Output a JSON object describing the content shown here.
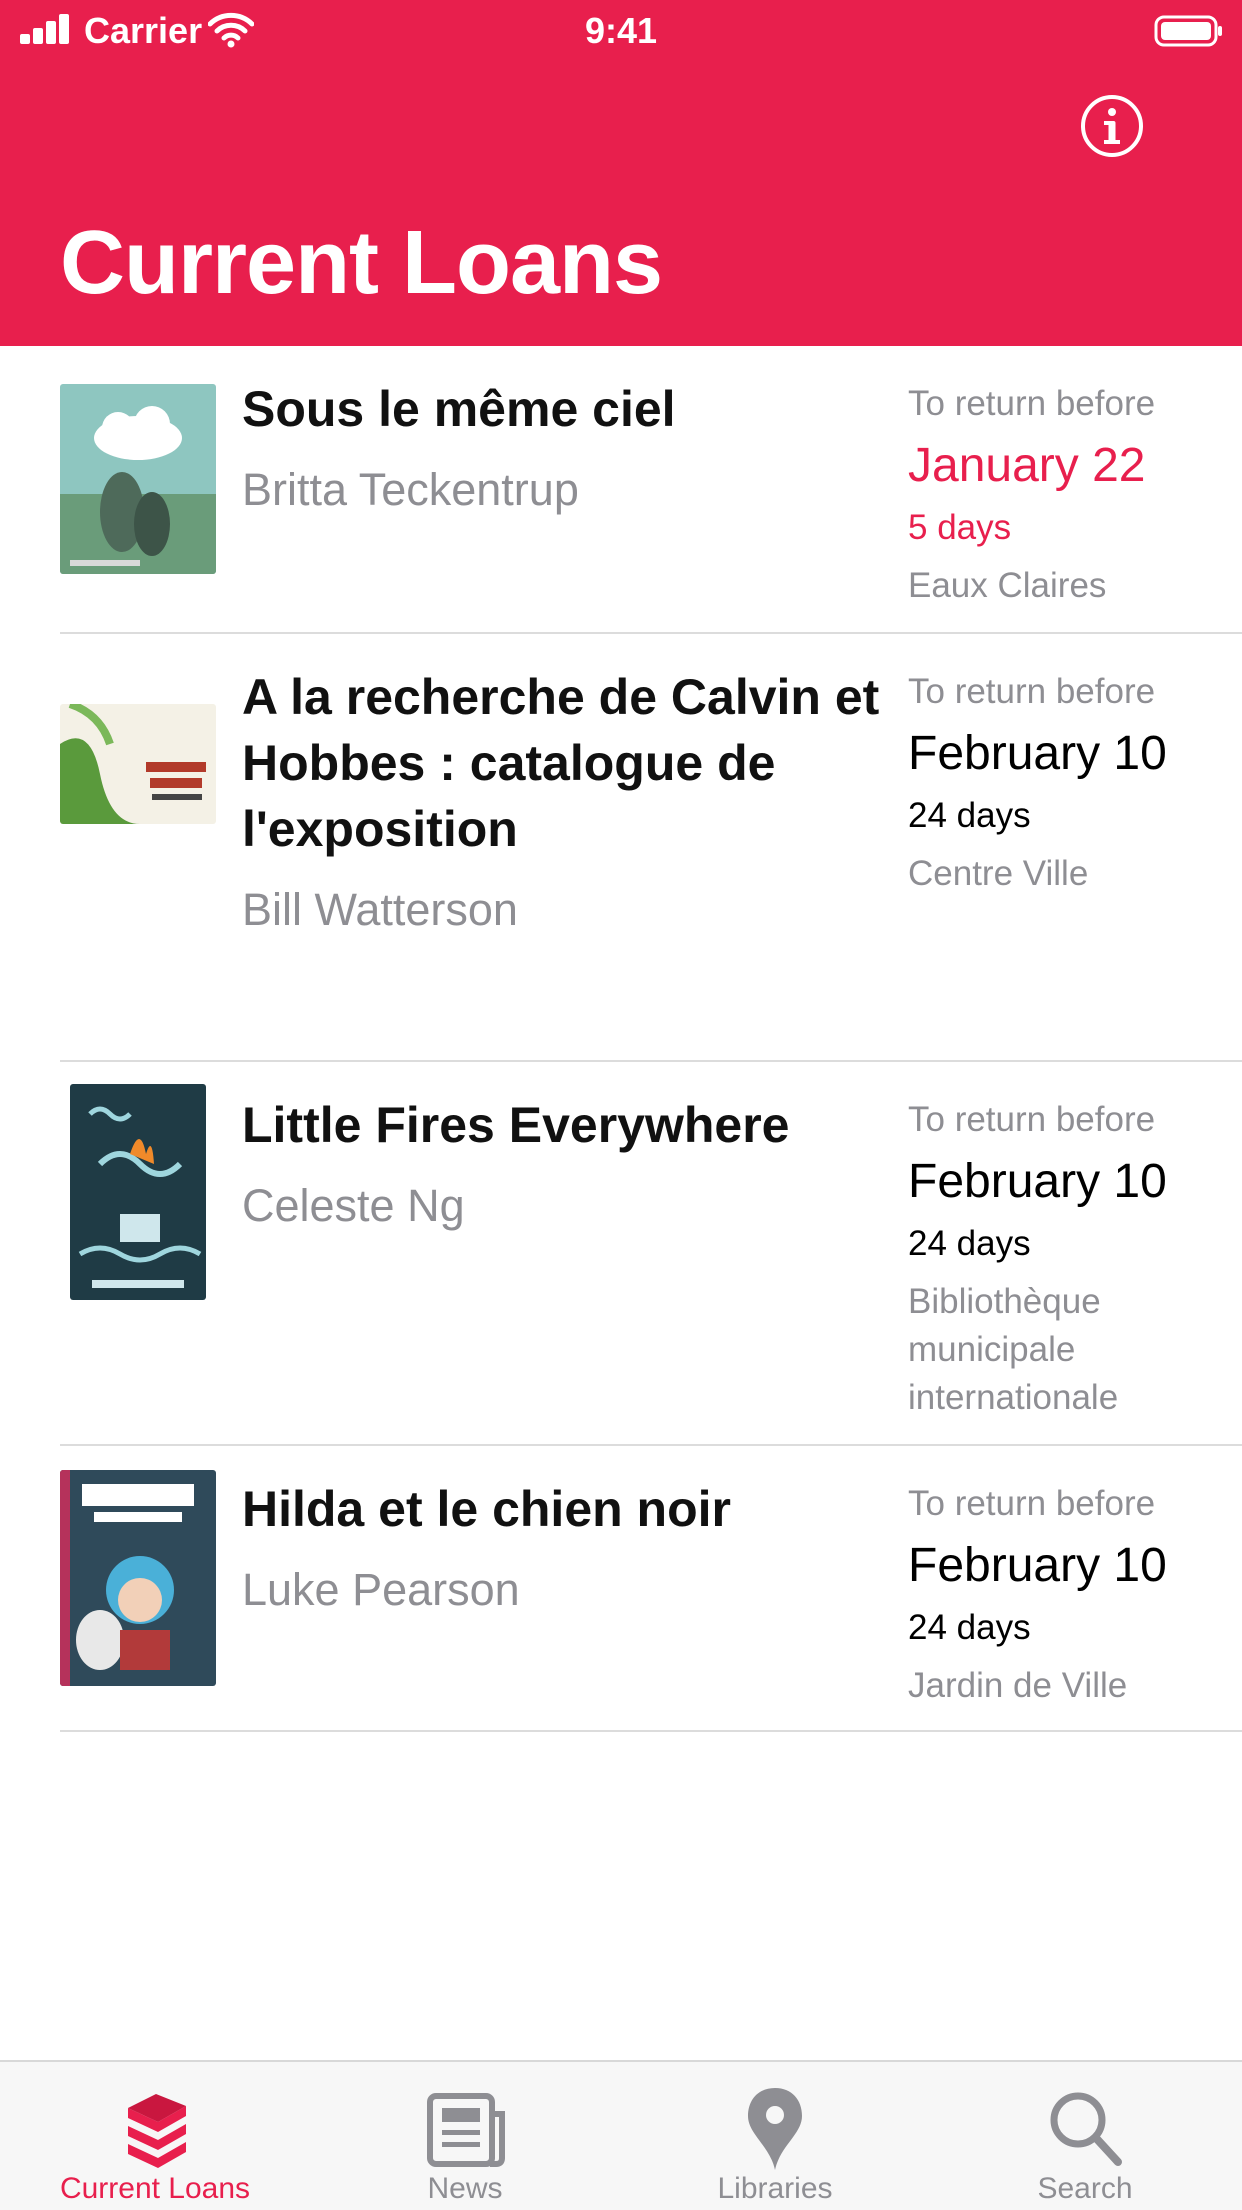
{
  "status_bar": {
    "carrier": "Carrier",
    "time": "9:41"
  },
  "header": {
    "title": "Current Loans",
    "info_icon": "info-circle-icon"
  },
  "colors": {
    "accent": "#e81f4d",
    "secondary_text": "#8e8e93"
  },
  "loans": [
    {
      "title": "Sous le même ciel",
      "author": "Britta Teckentrup",
      "due_label": "To return before",
      "due_date": "January 22",
      "days_left": "5 days",
      "library": "Eaux Claires",
      "urgent": true
    },
    {
      "title": "A la recherche de Calvin et Hobbes : catalogue de l'exposition",
      "author": "Bill Watterson",
      "due_label": "To return before",
      "due_date": "February 10",
      "days_left": "24 days",
      "library": "Centre Ville",
      "urgent": false
    },
    {
      "title": "Little Fires Everywhere",
      "author": "Celeste Ng",
      "due_label": "To return before",
      "due_date": "February 10",
      "days_left": "24 days",
      "library": "Bibliothèque municipale internationale",
      "urgent": false
    },
    {
      "title": "Hilda et le chien noir",
      "author": "Luke Pearson",
      "due_label": "To return before",
      "due_date": "February 10",
      "days_left": "24 days",
      "library": "Jardin de Ville",
      "urgent": false
    }
  ],
  "tab_bar": {
    "tabs": [
      {
        "label": "Current Loans",
        "icon": "books-stack-icon",
        "active": true
      },
      {
        "label": "News",
        "icon": "newspaper-icon",
        "active": false
      },
      {
        "label": "Libraries",
        "icon": "map-pin-icon",
        "active": false
      },
      {
        "label": "Search",
        "icon": "magnifier-icon",
        "active": false
      }
    ]
  }
}
